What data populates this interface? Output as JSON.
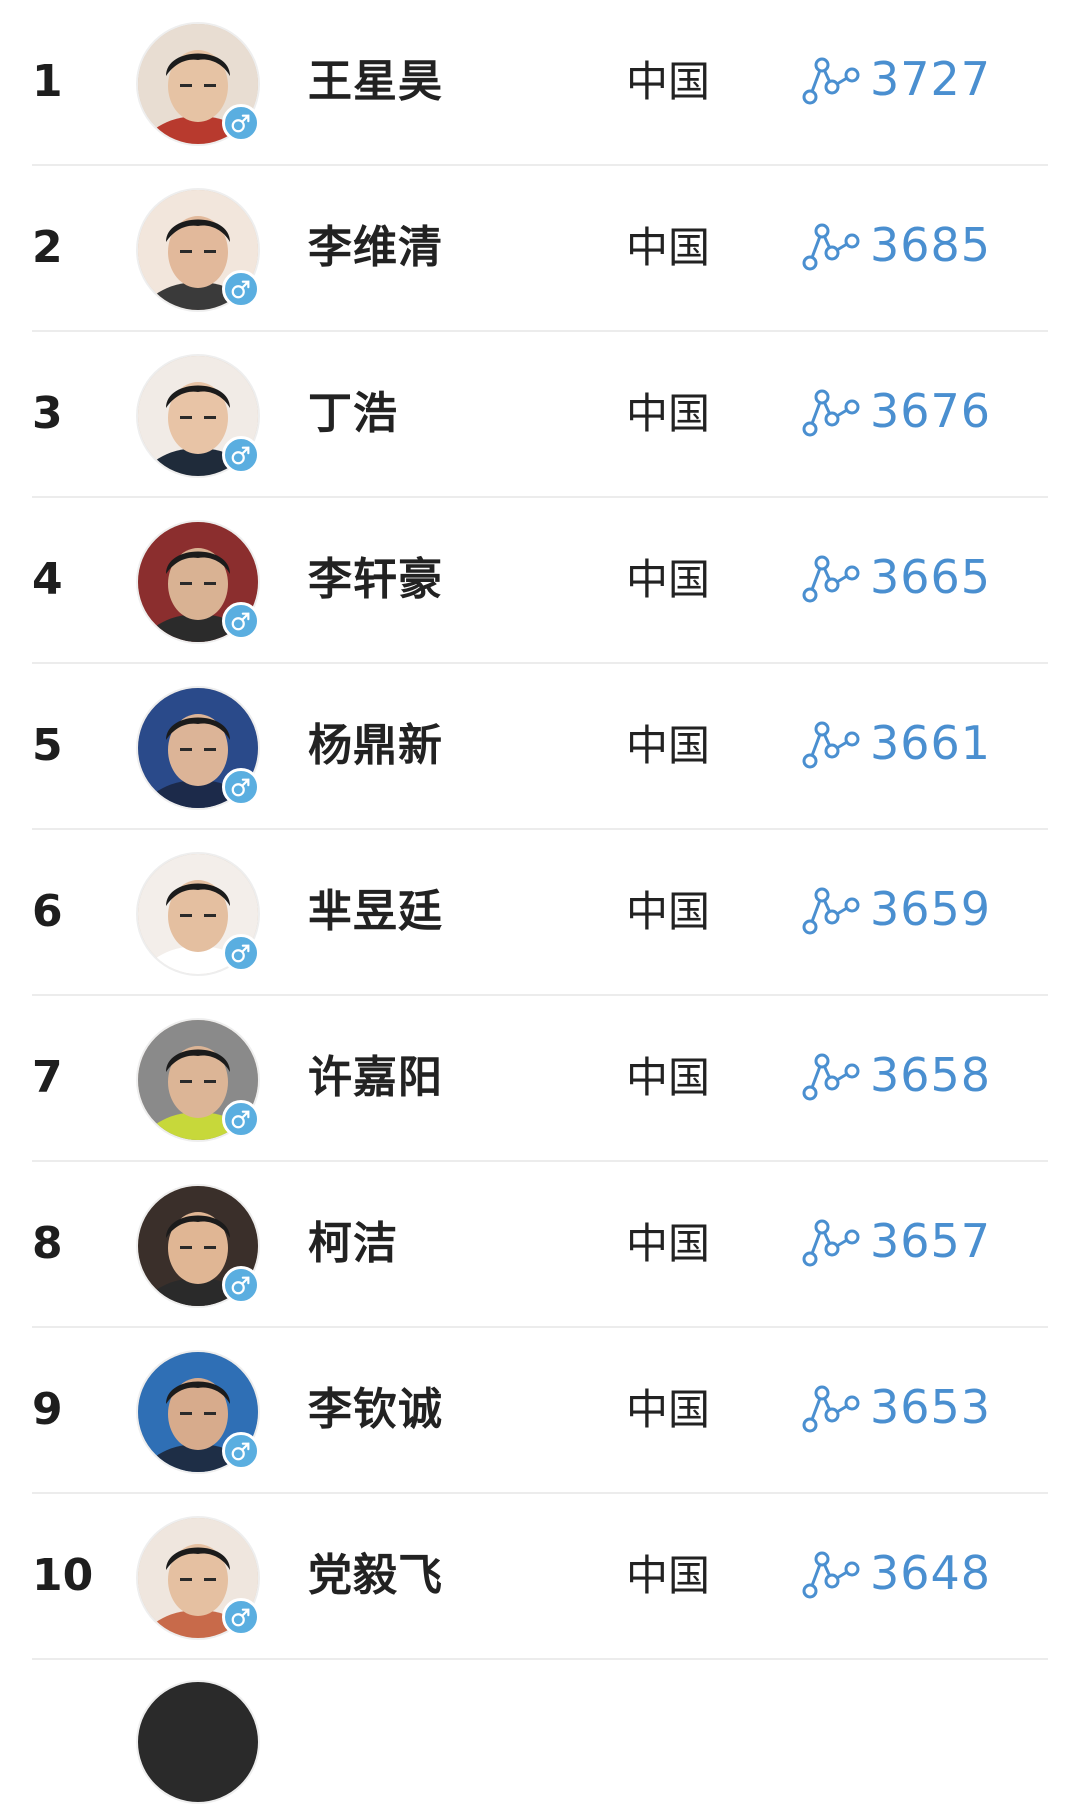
{
  "colors": {
    "score_accent": "#4a8fd0",
    "gender_badge": "#5aaee0",
    "divider": "#ececec"
  },
  "icons": {
    "gender": "male-icon",
    "trend": "line-chart-trend-icon"
  },
  "players": [
    {
      "rank": "1",
      "name": "王星昊",
      "country": "中国",
      "rating": "3727",
      "shirt": "#b83a2e",
      "skin": "#e6c3a4",
      "bg": "#e8ddd2"
    },
    {
      "rank": "2",
      "name": "李维清",
      "country": "中国",
      "rating": "3685",
      "shirt": "#3a3a3a",
      "skin": "#e2b99b",
      "bg": "#f2e6dc"
    },
    {
      "rank": "3",
      "name": "丁浩",
      "country": "中国",
      "rating": "3676",
      "shirt": "#1f2b3a",
      "skin": "#e8c4a6",
      "bg": "#f1ebe6"
    },
    {
      "rank": "4",
      "name": "李轩豪",
      "country": "中国",
      "rating": "3665",
      "shirt": "#2b2b2b",
      "skin": "#d9b293",
      "bg": "#8b2e2e"
    },
    {
      "rank": "5",
      "name": "杨鼎新",
      "country": "中国",
      "rating": "3661",
      "shirt": "#1c2a4a",
      "skin": "#dcb497",
      "bg": "#2a4a8a"
    },
    {
      "rank": "6",
      "name": "芈昱廷",
      "country": "中国",
      "rating": "3659",
      "shirt": "#ffffff",
      "skin": "#e4bfa0",
      "bg": "#f3eeea"
    },
    {
      "rank": "7",
      "name": "许嘉阳",
      "country": "中国",
      "rating": "3658",
      "shirt": "#c7d83a",
      "skin": "#dcb596",
      "bg": "#8a8a8a"
    },
    {
      "rank": "8",
      "name": "柯洁",
      "country": "中国",
      "rating": "3657",
      "shirt": "#2a2a2a",
      "skin": "#e0b694",
      "bg": "#3a2f2a"
    },
    {
      "rank": "9",
      "name": "李钦诚",
      "country": "中国",
      "rating": "3653",
      "shirt": "#1e2e46",
      "skin": "#d7ab8c",
      "bg": "#2f6fb5"
    },
    {
      "rank": "10",
      "name": "党毅飞",
      "country": "中国",
      "rating": "3648",
      "shirt": "#c86a4a",
      "skin": "#e5c0a1",
      "bg": "#efe6de"
    }
  ]
}
